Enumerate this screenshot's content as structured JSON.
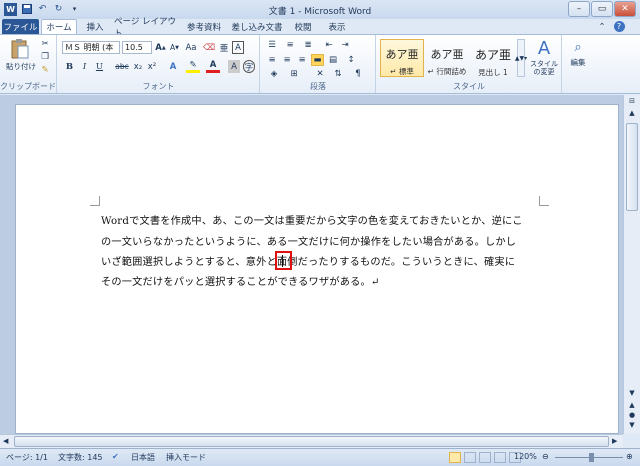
{
  "window": {
    "title": "文書 1 - Microsoft Word"
  },
  "qat": {
    "app_icon": "W",
    "save_icon": "save-icon",
    "undo_icon": "↶",
    "redo_icon": "↻"
  },
  "tabs": [
    {
      "label": "ファイル"
    },
    {
      "label": "ホーム"
    },
    {
      "label": "挿入"
    },
    {
      "label": "ページ レイアウト"
    },
    {
      "label": "参考資料"
    },
    {
      "label": "差し込み文書"
    },
    {
      "label": "校閲"
    },
    {
      "label": "表示"
    }
  ],
  "ribbon": {
    "clipboard": {
      "paste_label": "貼り付け",
      "group_label": "クリップボード"
    },
    "font": {
      "font_name": "ＭＳ 明朝 (本",
      "font_size": "10.5",
      "group_label": "フォント",
      "bold": "B",
      "italic": "I",
      "underline": "U",
      "strike": "abc",
      "sub": "x₂",
      "sup": "x²"
    },
    "paragraph": {
      "group_label": "段落"
    },
    "styles": {
      "group_label": "スタイル",
      "items": [
        {
          "sample": "あア亜",
          "name": "↵ 標準"
        },
        {
          "sample": "あア亜",
          "name": "↵ 行間詰め"
        },
        {
          "sample": "あア亜",
          "name": "見出し 1"
        }
      ],
      "change_styles": "スタイルの変更"
    },
    "editing": {
      "label": "編集"
    }
  },
  "document": {
    "lines": [
      "Wordで文書を作成中、あ、この一文は重要だから文字の色を変えておきたいとか、逆にこ",
      "の一文いらなかったというように、ある一文だけに何か操作をしたい場合がある。しかし",
      "いざ範囲選択しようとすると、意外と面倒だったりするものだ。こういうときに、確実に",
      "その一文だけをパッと選択することができるワザがある。↵"
    ]
  },
  "status": {
    "page": "ページ: 1/1",
    "words": "文字数: 145",
    "language": "日本語",
    "mode": "挿入モード",
    "zoom": "120%",
    "zoom_level_percent": 120
  }
}
